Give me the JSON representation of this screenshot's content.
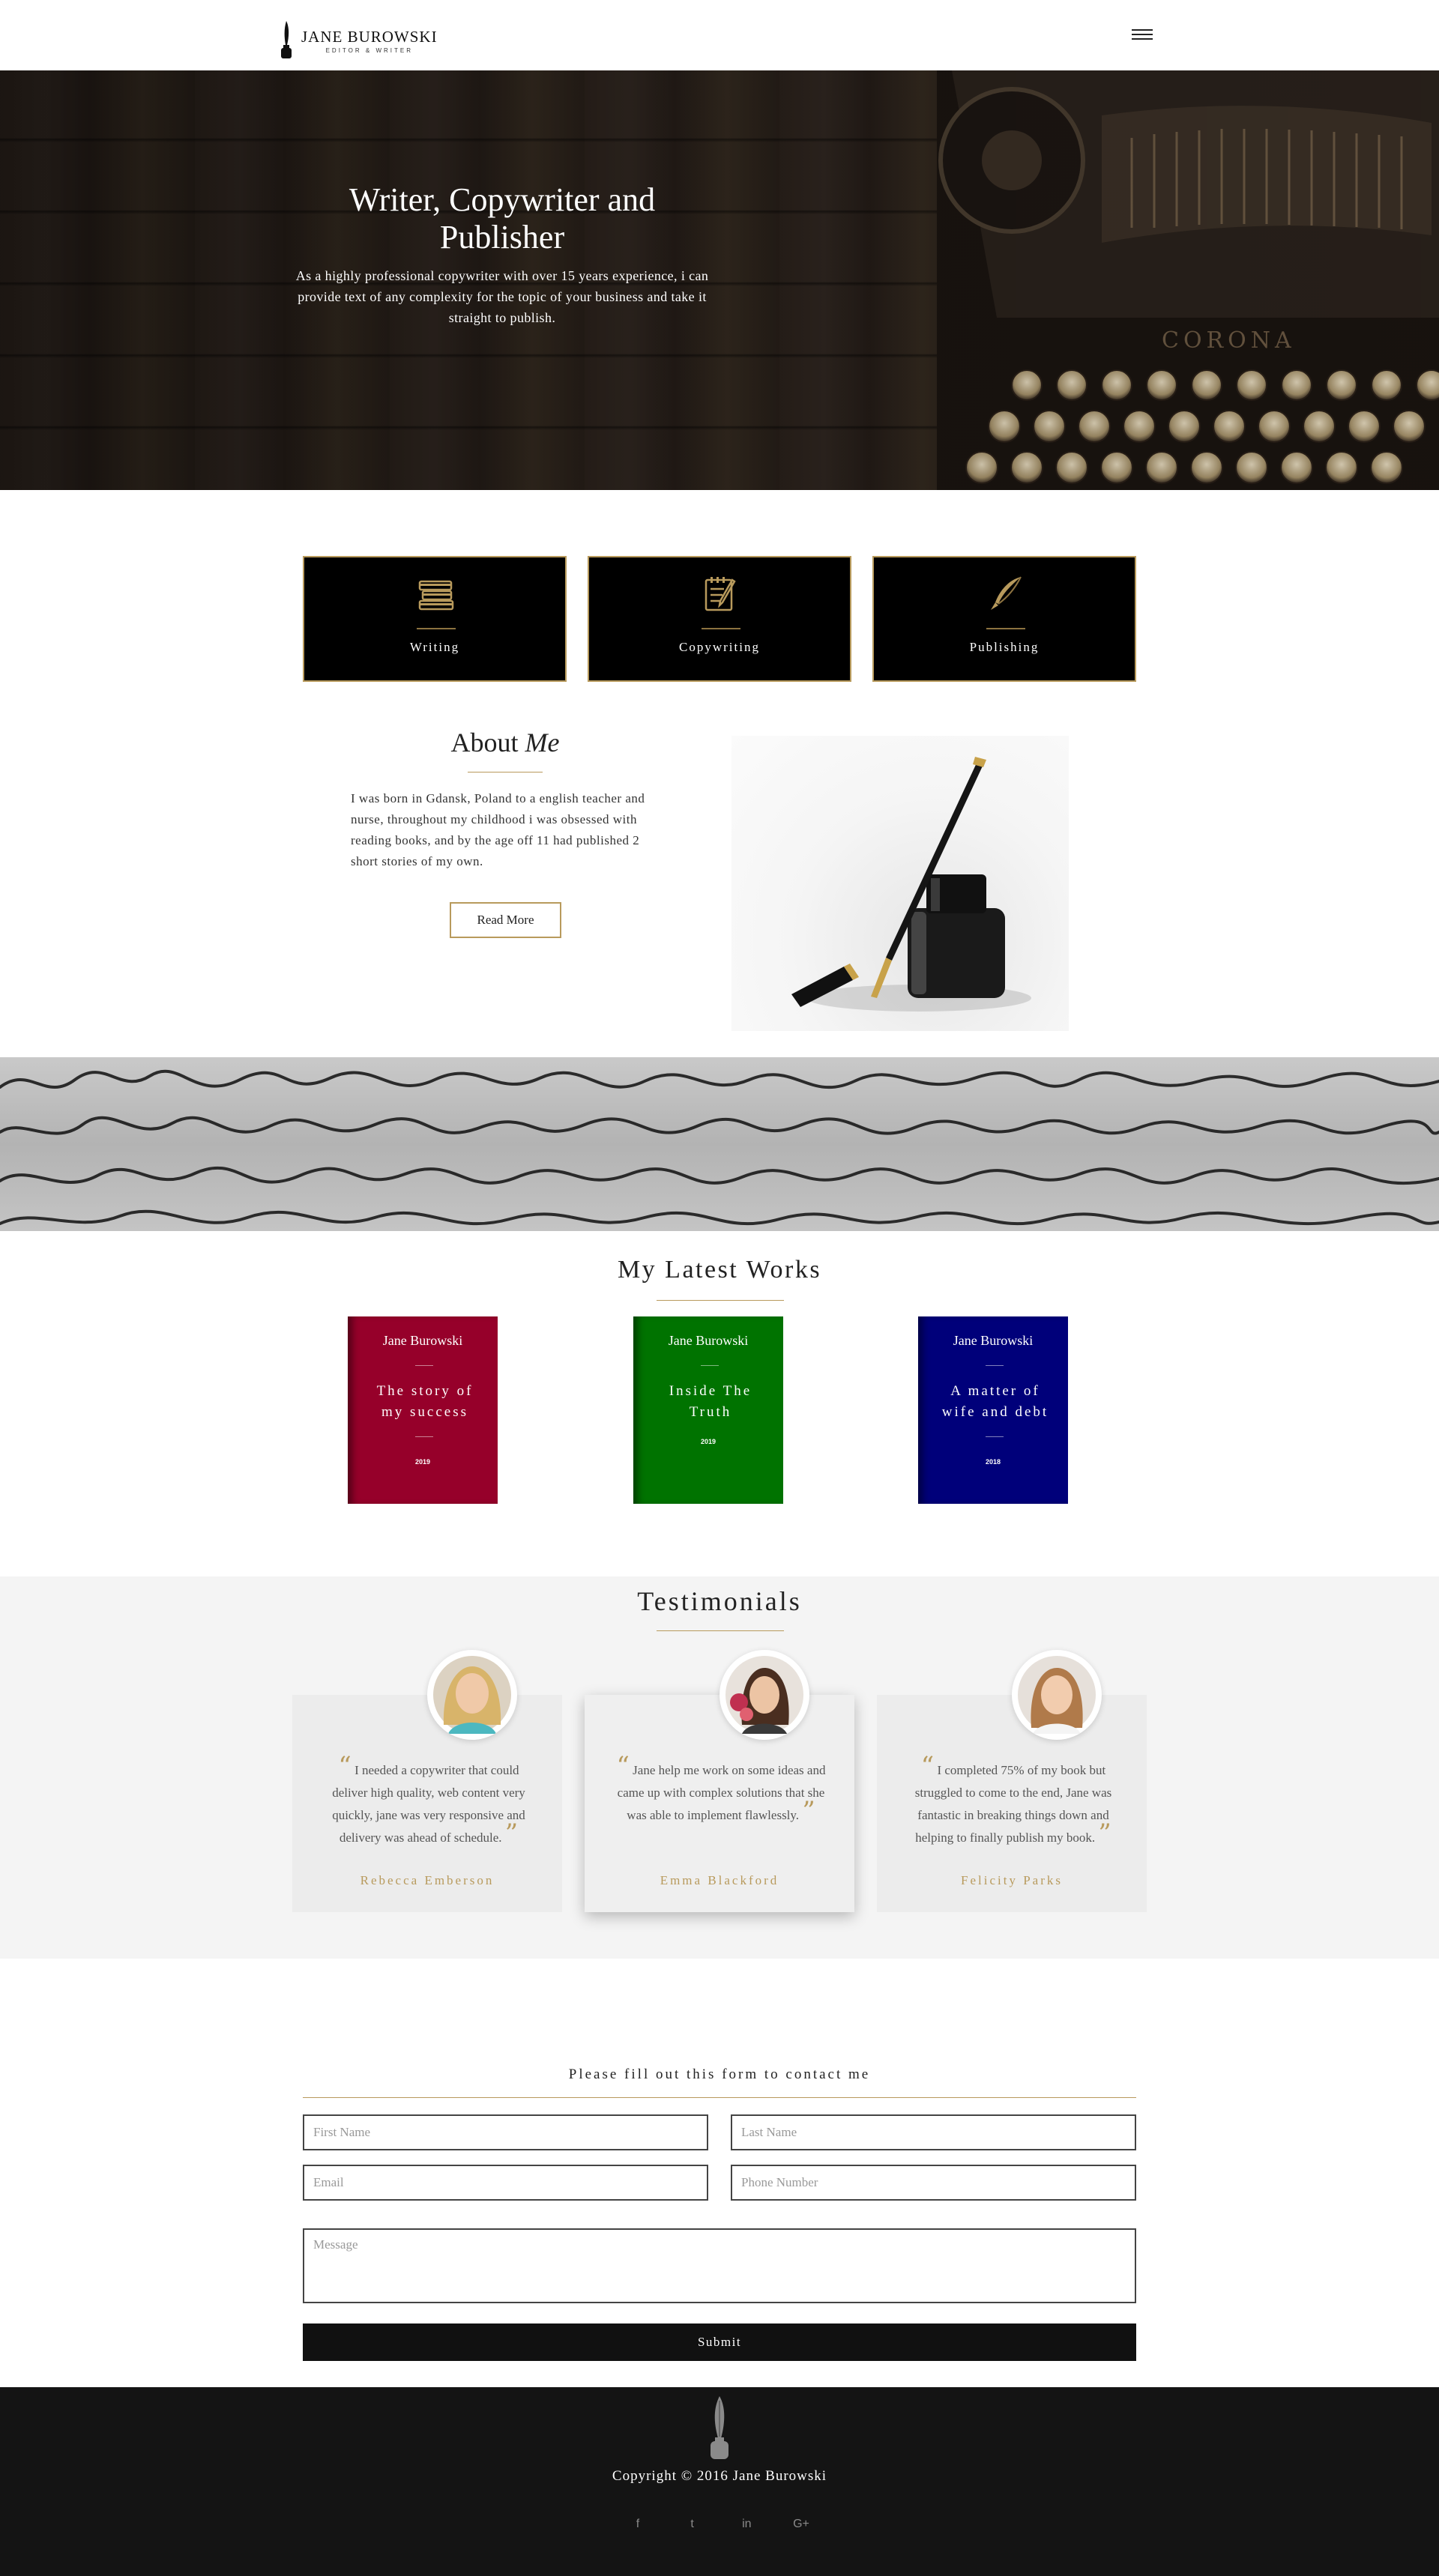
{
  "header": {
    "logo_title": "JANE BUROWSKI",
    "logo_subtitle": "EDITOR & WRITER"
  },
  "hero": {
    "title": "Writer, Copywriter and Publisher",
    "subtitle": "As a highly professional copywriter with over 15 years experience, i can provide text of any complexity for the topic of your business and take it straight to publish."
  },
  "services": [
    {
      "label": "Writing",
      "icon": "books-icon"
    },
    {
      "label": "Copywriting",
      "icon": "notepad-pencil-icon"
    },
    {
      "label": "Publishing",
      "icon": "quill-pen-icon"
    }
  ],
  "about": {
    "title_plain": "About",
    "title_em": "Me",
    "text": "I was born in Gdansk, Poland to a english teacher and nurse, throughout my childhood i was obsessed with reading books, and by the age off 11 had published 2 short stories of my own.",
    "button": "Read More"
  },
  "works": {
    "title": "My Latest Works",
    "books": [
      {
        "author": "Jane Burowski",
        "title": "The story of my success",
        "year": "2019",
        "color": "#96002a"
      },
      {
        "author": "Jane Burowski",
        "title": "Inside The Truth",
        "year": "2019",
        "color": "#007300"
      },
      {
        "author": "Jane Burowski",
        "title": "A matter of wife and debt",
        "year": "2018",
        "color": "#00007a"
      }
    ]
  },
  "testimonials": {
    "title": "Testimonials",
    "items": [
      {
        "quote": "I needed a copywriter that could deliver high quality, web content very quickly, jane was very responsive and delivery was ahead of schedule.",
        "name": "Rebecca Emberson"
      },
      {
        "quote": "Jane help me work on some ideas and came up with complex solutions that she was able to implement flawlessly.",
        "name": "Emma Blackford"
      },
      {
        "quote": "I completed 75% of my book but struggled to come to the end, Jane was fantastic in breaking things down and helping to finally publish my book.",
        "name": "Felicity Parks"
      }
    ]
  },
  "contact": {
    "heading": "Please fill out this form to contact me",
    "first_name_placeholder": "First Name",
    "last_name_placeholder": "Last Name",
    "email_placeholder": "Email",
    "phone_placeholder": "Phone Number",
    "message_placeholder": "Message",
    "submit": "Submit"
  },
  "footer": {
    "copyright": "Copyright © 2016 Jane Burowski",
    "socials": [
      {
        "icon": "facebook-icon",
        "glyph": "f"
      },
      {
        "icon": "twitter-icon",
        "glyph": "t"
      },
      {
        "icon": "linkedin-icon",
        "glyph": "in"
      },
      {
        "icon": "google-plus-icon",
        "glyph": "G+"
      }
    ]
  },
  "colors": {
    "accent_gold": "#b89a5c",
    "dark": "#111111",
    "testimonials_bg": "#f4f4f4"
  }
}
